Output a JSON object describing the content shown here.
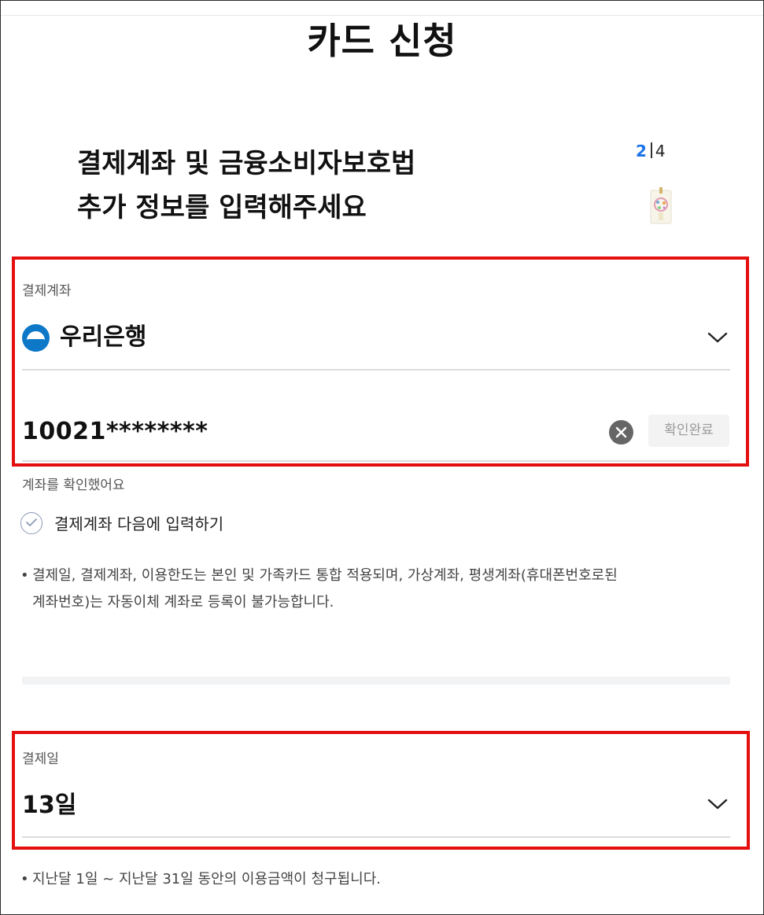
{
  "page": {
    "title": "카드 신청"
  },
  "step": {
    "current": "2",
    "total": "4"
  },
  "heading": {
    "line1": "결제계좌 및 금융소비자보호법",
    "line2": "추가 정보를 입력해주세요"
  },
  "payment_account": {
    "label": "결제계좌",
    "bank_name": "우리은행",
    "bank_logo_icon": "woori-bank-logo",
    "account_number": "10021********",
    "confirm_button": "확인완료",
    "status_text": "계좌를 확인했어요",
    "enter_later_label": "결제계좌 다음에 입력하기",
    "notice": {
      "line1": "결제일, 결제계좌, 이용한도는 본인 및 가족카드 통합 적용되며, 가상계좌, 평생계좌(휴대폰번호로된",
      "line2": "계좌번호)는 자동이체 계좌로 등록이 불가능합니다."
    }
  },
  "payment_date": {
    "label": "결제일",
    "value": "13일",
    "notice": "지난달 1일 ~ 지난달 31일 동안의 이용금액이 청구됩니다."
  },
  "colors": {
    "highlight_border": "#e40f0f",
    "step_current": "#1a73e8",
    "bank_brand": "#0d78c8"
  }
}
